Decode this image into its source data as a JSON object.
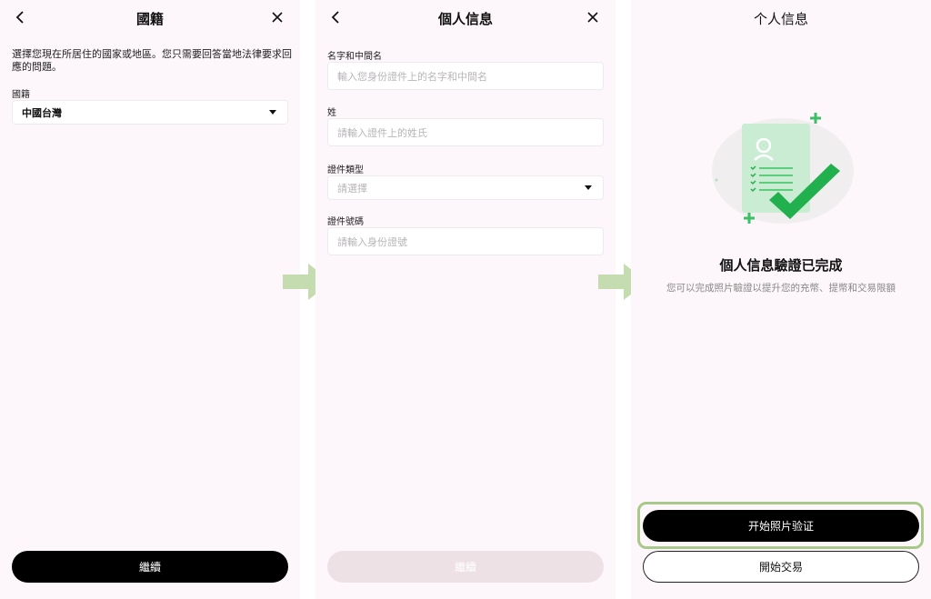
{
  "screen1": {
    "title": "國籍",
    "description": "選擇您現在所居住的國家或地區。您只需要回答當地法律要求回應的問題。",
    "nationality_label": "國籍",
    "nationality_value": "中國台灣",
    "continue_label": "繼續"
  },
  "screen2": {
    "title": "個人信息",
    "fields": [
      {
        "label": "名字和中間名",
        "placeholder": "輸入您身份證件上的名字和中間名"
      },
      {
        "label": "姓",
        "placeholder": "請輸入證件上的姓氏"
      },
      {
        "label": "證件類型",
        "placeholder": "請選擇"
      },
      {
        "label": "證件號碼",
        "placeholder": "請輸入身份證號"
      }
    ],
    "continue_label": "繼續"
  },
  "screen3": {
    "title": "个人信息",
    "complete_title": "個人信息驗證已完成",
    "complete_subtitle": "您可以完成照片驗證以提升您的充幣、提幣和交易限額",
    "photo_verify_label": "开始照片验证",
    "start_trading_label": "開始交易"
  },
  "colors": {
    "panel_bg": "#fdf7fb",
    "arrow": "#c5dbb0",
    "highlight": "#a8c98a",
    "check_green": "#22b04e"
  },
  "icons": [
    "back-icon",
    "close-icon",
    "caret-down-icon",
    "flow-arrow-icon",
    "document-check-illustration"
  ]
}
